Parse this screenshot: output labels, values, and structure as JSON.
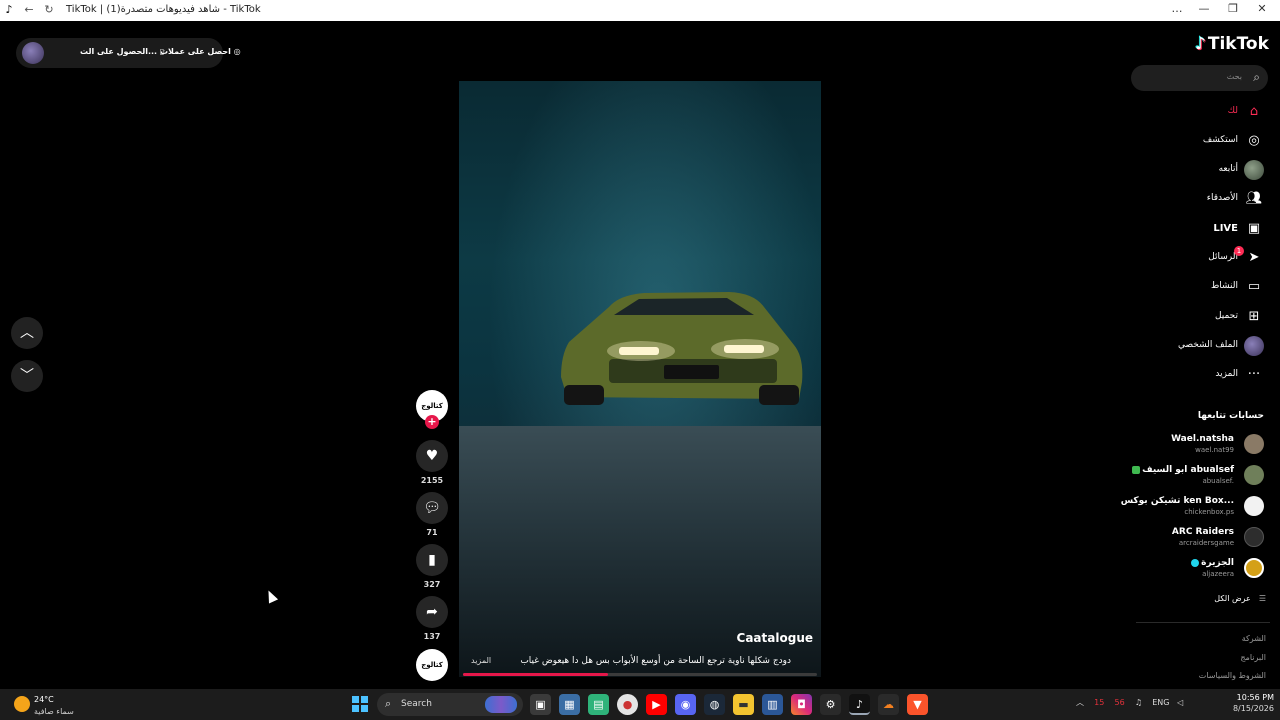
{
  "browser": {
    "title": "TikTok | شاهد فيديوهات متصدرة(1) - TikTok",
    "controls": [
      "…",
      "—",
      "❐",
      "✕"
    ]
  },
  "top_pill": {
    "item_a": "الحصول على الت...",
    "item_b": "احصل على عملات"
  },
  "video": {
    "author": "Caatalogue",
    "caption": "دودج شكلها ناوية ترجع الساحة من أوسع الأبواب بس هل دا هيعوض غياب",
    "more_label": "المزيد",
    "progress_fraction": 0.41
  },
  "actions": {
    "author_badge": "كتالوج",
    "likes": "2155",
    "comments": "71",
    "saves": "327",
    "shares": "137",
    "music_badge": "كتالوج"
  },
  "sidebar": {
    "logo": "TikTok",
    "search_placeholder": "بحث",
    "nav": [
      {
        "label": "لك",
        "icon": "home-icon",
        "active": true
      },
      {
        "label": "استكشف",
        "icon": "compass-icon"
      },
      {
        "label": "أتابعه",
        "icon": "avatar"
      },
      {
        "label": "الأصدقاء",
        "icon": "friends-icon"
      },
      {
        "label": "LIVE",
        "icon": "live-icon"
      },
      {
        "label": "الرسائل",
        "icon": "send-icon",
        "badge": "1"
      },
      {
        "label": "النشاط",
        "icon": "activity-icon"
      },
      {
        "label": "تحميل",
        "icon": "upload-icon"
      },
      {
        "label": "الملف الشخصي",
        "icon": "avatar"
      },
      {
        "label": "المزيد",
        "icon": "more-icon"
      }
    ],
    "following_title": "حسابات تتابعها",
    "accounts": [
      {
        "name": "Wael.natsha",
        "handle": "wael.nat99",
        "color": "#8a7a66"
      },
      {
        "name": "ابو السيف abualsef",
        "handle": "abualsef.",
        "color": "#6f7f5a",
        "badge_color": "#3fb950"
      },
      {
        "name": "تشيكن بوكس Chicken Box",
        "display": "تشيكن بوكس ken Box...",
        "handle": "chickenbox.ps",
        "color": "#f2f2f2"
      },
      {
        "name": "ARC Raiders",
        "handle": "arcraidersgame",
        "color": "#2d2d2d"
      },
      {
        "name": "الجزيرة",
        "handle": "aljazeera",
        "color": "#d4a017",
        "badge_color": "#20d5ec"
      }
    ],
    "see_all": "عرض الكل",
    "footer": [
      "الشركة",
      "البرنامج",
      "الشروط والسياسات"
    ]
  },
  "taskbar": {
    "temp": "24°C",
    "condition": "سماء صافية",
    "search": "Search",
    "lang": "ENG",
    "tray_a": "15",
    "tray_b": "56",
    "time": "10:56 PM",
    "date": "8/15/2026"
  },
  "colors": {
    "accent": "#fe2c55",
    "progress": "#e6174a",
    "background": "#000000"
  }
}
